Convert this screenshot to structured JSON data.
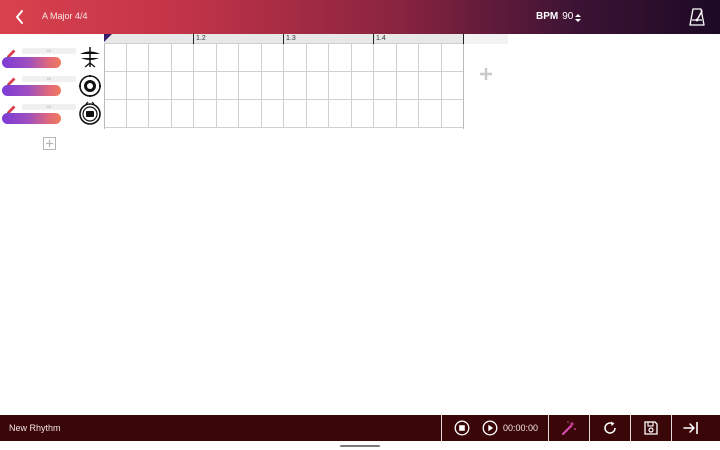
{
  "header": {
    "title": "A Major 4/4",
    "bpm_label": "BPM",
    "bpm_value": "90",
    "back_icon": "chevron-left-icon",
    "metronome_icon": "metronome-icon"
  },
  "tracks": [
    {
      "instrument": "hi-hat-icon",
      "slider_text": "· 68 ·"
    },
    {
      "instrument": "snare-drum-icon",
      "slider_text": "· 68 ·"
    },
    {
      "instrument": "bass-drum-icon",
      "slider_text": "· 68 ·"
    }
  ],
  "ruler": {
    "labels": [
      "1.2",
      "1.3",
      "1.4"
    ]
  },
  "grid": {
    "columns": 16,
    "rows": 3
  },
  "footer": {
    "rhythm_name": "New Rhythm",
    "timecode": "00:00:00"
  },
  "colors": {
    "header_gradient_start": "#d9414d",
    "header_gradient_end": "#1c0a24",
    "footer_bg": "#3a0608",
    "accent_purple": "#7b3bd6",
    "accent_coral": "#f07a5c",
    "pencil_red": "#d9414d"
  }
}
